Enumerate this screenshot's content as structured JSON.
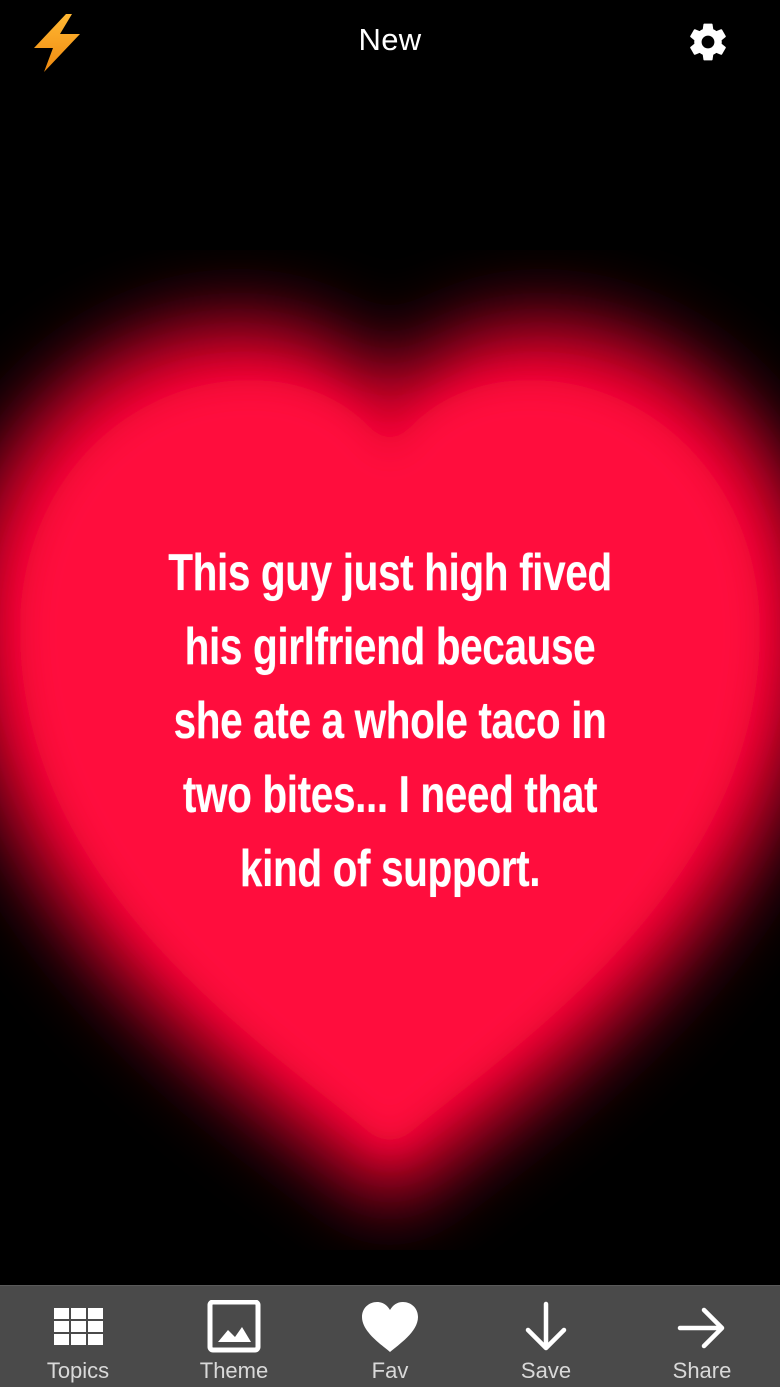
{
  "header": {
    "title": "New",
    "left_icon": "lightning-bolt-icon",
    "right_icon": "gear-icon"
  },
  "card": {
    "quote": "This guy just high fived his girlfriend because she ate a whole taco in two bites... I need that kind of support.",
    "background_icon": "heart-icon",
    "colors": {
      "background": "#000000",
      "heart": "#ff0a3c",
      "text": "#ffffff"
    }
  },
  "tabbar": {
    "items": [
      {
        "label": "Topics",
        "icon": "grid-icon"
      },
      {
        "label": "Theme",
        "icon": "image-icon"
      },
      {
        "label": "Fav",
        "icon": "heart-icon"
      },
      {
        "label": "Save",
        "icon": "arrow-down-icon"
      },
      {
        "label": "Share",
        "icon": "arrow-right-icon"
      }
    ],
    "colors": {
      "background": "#4a4a4a",
      "label": "#d9d9d9",
      "icon": "#ffffff"
    }
  },
  "colors": {
    "bolt": "#f5a623"
  }
}
